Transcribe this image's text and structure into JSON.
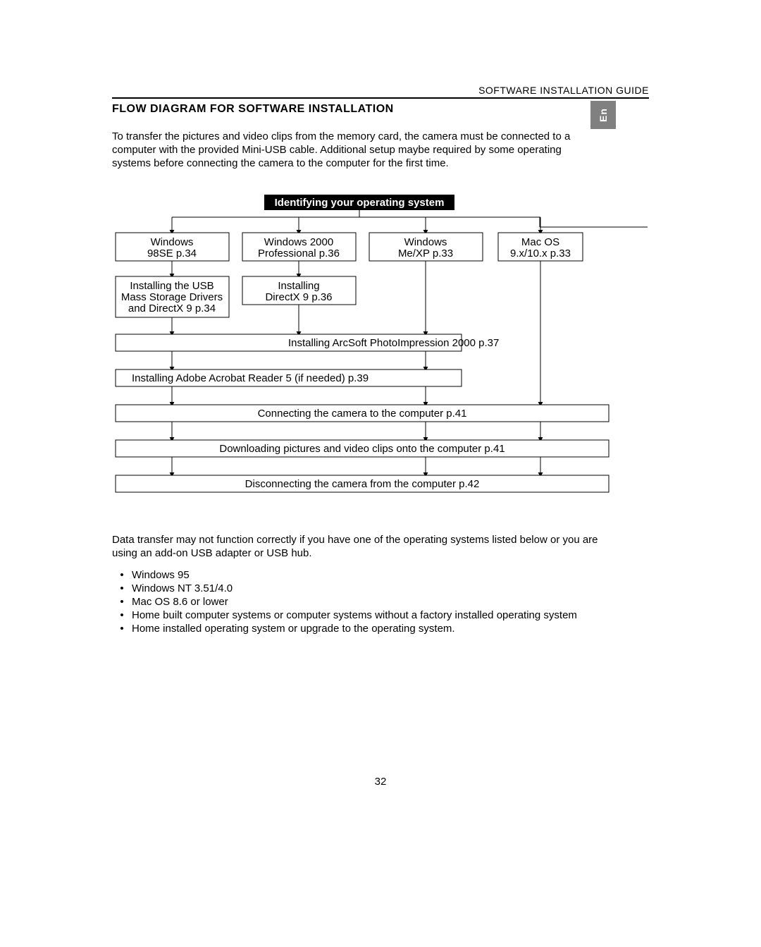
{
  "header": {
    "doc_label": "SOFTWARE INSTALLATION GUIDE",
    "section_title": "FLOW DIAGRAM FOR SOFTWARE INSTALLATION",
    "lang_tab": "En"
  },
  "intro": "To transfer the pictures and video clips from the memory card, the camera must be connected to a computer with the provided Mini-USB cable.  Additional setup maybe required by some operating systems before connecting the camera to the computer for the first time.",
  "flow": {
    "banner": "Identifying your operating system",
    "os": {
      "col1_l1": "Windows",
      "col1_l2": "98SE p.34",
      "col2_l1": "Windows 2000",
      "col2_l2": "Professional p.36",
      "col3_l1": "Windows",
      "col3_l2": "Me/XP p.33",
      "col4_l1": "Mac OS",
      "col4_l2": "9.x/10.x p.33"
    },
    "step2": {
      "col1_l1": "Installing the USB",
      "col1_l2": "Mass Storage Drivers",
      "col1_l3": "and DirectX 9 p.34",
      "col2_l1": "Installing",
      "col2_l2": "DirectX 9 p.36"
    },
    "arcsoft": "Installing ArcSoft PhotoImpression 2000 p.37",
    "acrobat": "Installing Adobe Acrobat Reader 5 (if needed) p.39",
    "connect": "Connecting the camera to the computer p.41",
    "download": "Downloading pictures and video clips onto the computer p.41",
    "disconnect": "Disconnecting the camera from the computer p.42"
  },
  "footer_para": "Data transfer may not function correctly if you have one of the operating systems listed below or you are using an add-on USB adapter or USB hub.",
  "bullets": {
    "b1": "Windows 95",
    "b2": "Windows NT 3.51/4.0",
    "b3": "Mac OS 8.6 or lower",
    "b4": "Home built computer systems or computer systems without a factory installed operating system",
    "b5": "Home installed operating system or upgrade to the operating system."
  },
  "page_number": "32"
}
